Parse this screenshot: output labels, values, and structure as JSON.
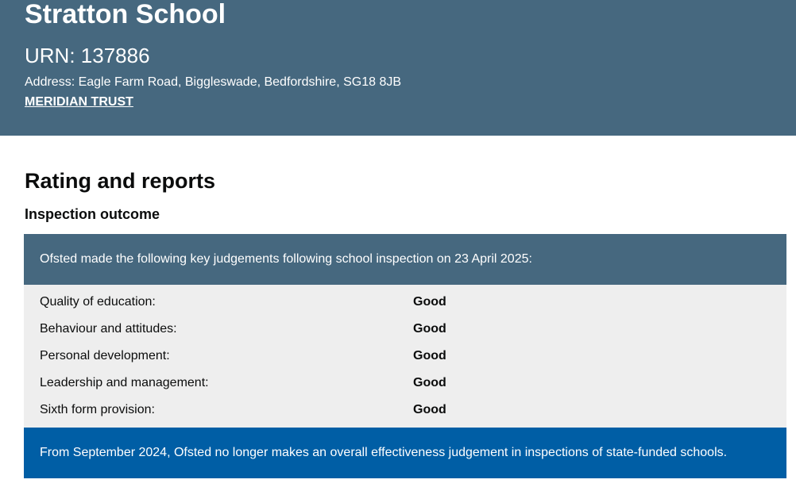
{
  "header": {
    "school_name": "Stratton School",
    "urn": "URN: 137886",
    "address": "Address: Eagle Farm Road, Biggleswade, Bedfordshire, SG18 8JB",
    "trust_link": "MERIDIAN TRUST"
  },
  "main": {
    "section_title": "Rating and reports",
    "subsection_title": "Inspection outcome",
    "judgement_intro": "Ofsted made the following key judgements following school inspection on 23 April 2025:",
    "judgements": [
      {
        "label": "Quality of education:",
        "value": "Good"
      },
      {
        "label": "Behaviour and attitudes:",
        "value": "Good"
      },
      {
        "label": "Personal development:",
        "value": "Good"
      },
      {
        "label": "Leadership and management:",
        "value": "Good"
      },
      {
        "label": "Sixth form provision:",
        "value": "Good"
      }
    ],
    "notice": "From September 2024, Ofsted no longer makes an overall effectiveness judgement in inspections of state-funded schools."
  },
  "colors": {
    "header_bg": "#46687f",
    "table_bg": "#eeeeee",
    "notice_bg": "#005ea5"
  }
}
